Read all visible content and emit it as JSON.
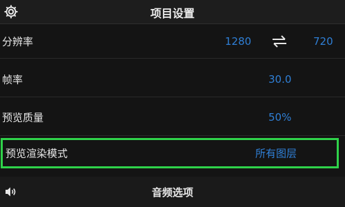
{
  "header": {
    "title": "项目设置",
    "icon": "gear-icon"
  },
  "settings": {
    "resolution": {
      "label": "分辨率",
      "width": "1280",
      "height": "720",
      "swap_icon": "swap-arrows-icon"
    },
    "frame_rate": {
      "label": "帧率",
      "value": "30.0"
    },
    "preview_quality": {
      "label": "预览质量",
      "value": "50%"
    },
    "preview_render_mode": {
      "label": "预览渲染模式",
      "value": "所有图层",
      "highlighted": true
    }
  },
  "footer": {
    "title": "音频选项",
    "icon": "speaker-icon"
  },
  "colors": {
    "background": "#141414",
    "value_blue": "#2f7fd6",
    "highlight_green": "#2fd34a"
  }
}
